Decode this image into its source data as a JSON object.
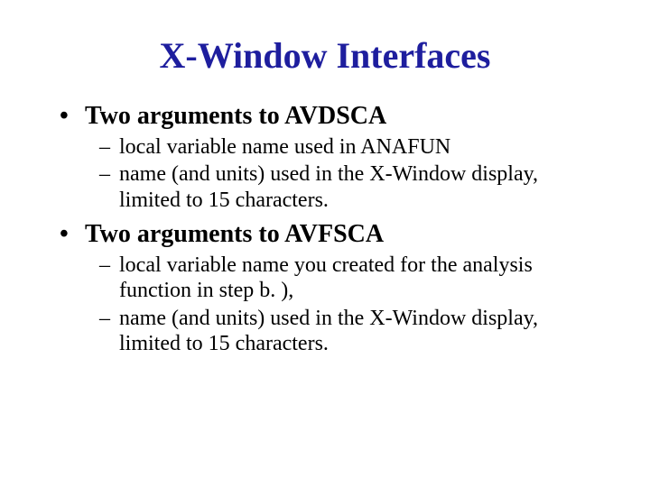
{
  "title": "X-Window Interfaces",
  "items": [
    {
      "label": "Two arguments to AVDSCA",
      "sub": [
        "local variable name used in ANAFUN",
        "name (and units) used in the X-Window display, limited to 15 characters."
      ]
    },
    {
      "label": "Two arguments to AVFSCA",
      "sub": [
        "local variable name you created for the analysis function in step b. ),",
        "name (and units) used in the X-Window display, limited to 15 characters."
      ]
    }
  ]
}
